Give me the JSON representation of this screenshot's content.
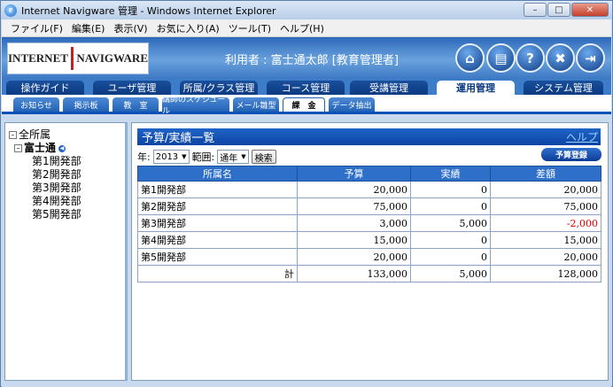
{
  "window": {
    "title": "Internet Navigware 管理 - Windows Internet Explorer"
  },
  "menu": [
    "ファイル(F)",
    "編集(E)",
    "表示(V)",
    "お気に入り(A)",
    "ツール(T)",
    "ヘルプ(H)"
  ],
  "header": {
    "logo_left": "INTERNET",
    "logo_right": "NAVIGWARE",
    "user_text": "利用者 : 富士通太郎 [教育管理者]"
  },
  "tabs": [
    "操作ガイド",
    "ユーザ管理",
    "所属/クラス管理",
    "コース管理",
    "受講管理",
    "運用管理",
    "システム管理"
  ],
  "active_tab": "運用管理",
  "subtabs": [
    "お知らせ",
    "掲示板",
    "教　室",
    "講師のスケジュール",
    "メール雛型",
    "課　金",
    "データ抽出"
  ],
  "active_subtab": "課　金",
  "tree": {
    "root": "全所属",
    "company": "富士通",
    "departments": [
      "第1開発部",
      "第2開発部",
      "第3開発部",
      "第4開発部",
      "第5開発部"
    ]
  },
  "main": {
    "title": "予算/実績一覧",
    "help": "ヘルプ",
    "year_label": "年:",
    "year_value": "2013",
    "range_label": "範囲:",
    "range_value": "通年",
    "search_button": "検索",
    "register_button": "予算登録"
  },
  "table": {
    "headers": [
      "所属名",
      "予算",
      "実績",
      "差額"
    ],
    "rows": [
      {
        "name": "第1開発部",
        "budget": "20,000",
        "actual": "0",
        "diff": "20,000",
        "negative": false
      },
      {
        "name": "第2開発部",
        "budget": "75,000",
        "actual": "0",
        "diff": "75,000",
        "negative": false
      },
      {
        "name": "第3開発部",
        "budget": "3,000",
        "actual": "5,000",
        "diff": "-2,000",
        "negative": true
      },
      {
        "name": "第4開発部",
        "budget": "15,000",
        "actual": "0",
        "diff": "15,000",
        "negative": false
      },
      {
        "name": "第5開発部",
        "budget": "20,000",
        "actual": "0",
        "diff": "20,000",
        "negative": false
      }
    ],
    "total": {
      "label": "計",
      "budget": "133,000",
      "actual": "5,000",
      "diff": "128,000"
    }
  }
}
